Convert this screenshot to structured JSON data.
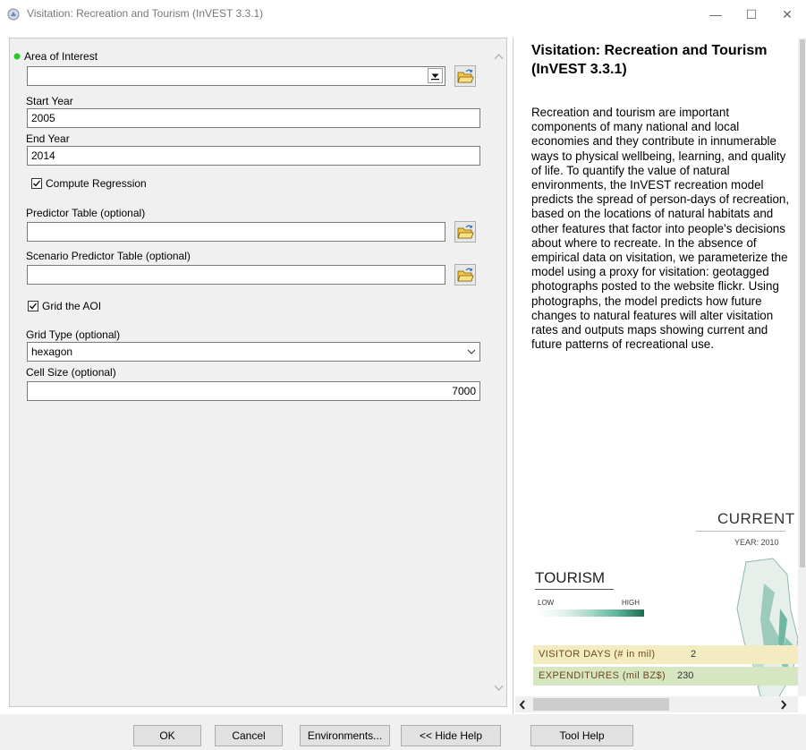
{
  "window": {
    "title": "Visitation: Recreation and Tourism (InVEST 3.3.1)",
    "minimize": "—",
    "maximize": "☐",
    "close": "✕"
  },
  "form": {
    "aoi_label": "Area of Interest",
    "aoi_value": "",
    "start_year_label": "Start Year",
    "start_year_value": "2005",
    "end_year_label": "End Year",
    "end_year_value": "2014",
    "compute_regression_label": "Compute Regression",
    "compute_regression_checked": true,
    "predictor_table_label": "Predictor Table (optional)",
    "predictor_table_value": "",
    "scenario_predictor_label": "Scenario Predictor Table (optional)",
    "scenario_predictor_value": "",
    "grid_aoi_label": "Grid the AOI",
    "grid_aoi_checked": true,
    "grid_type_label": "Grid Type (optional)",
    "grid_type_value": "hexagon",
    "cell_size_label": "Cell Size (optional)",
    "cell_size_value": "7000"
  },
  "help": {
    "title": "Visitation: Recreation and Tourism (InVEST 3.3.1)",
    "body": "Recreation and tourism are important components of many national and local economies and they contribute in innumerable ways to physical wellbeing, learning, and quality of life. To quantify the value of natural environments, the InVEST recreation model predicts the spread of person-days of recreation, based on the locations of natural habitats and other features that factor into people's decisions about where to recreate. In the absence of empirical data on visitation, we parameterize the model using a proxy for visitation: geotagged photographs posted to the website flickr. Using photographs, the model predicts how future changes to natural features will alter visitation rates and outputs maps showing current and future patterns of recreational use.",
    "figure": {
      "current": "CURRENT",
      "year": "YEAR: 2010",
      "tourism": "TOURISM",
      "low": "LOW",
      "high": "HIGH",
      "visitor_days_label": "VISITOR DAYS (# in mil)",
      "visitor_days_value": "2",
      "expenditures_label": "EXPENDITURES (mil BZ$)",
      "expenditures_value": "230"
    }
  },
  "buttons": {
    "ok": "OK",
    "cancel": "Cancel",
    "environments": "Environments...",
    "hide_help": "<< Hide Help",
    "tool_help": "Tool Help"
  },
  "colors": {
    "status_green": "#22cc22",
    "folder_yellow": "#f5c64a",
    "tourism_dark": "#1b6b4f",
    "visitor_band": "#f3ecc0",
    "expenditure_band": "#d5e6c1"
  }
}
